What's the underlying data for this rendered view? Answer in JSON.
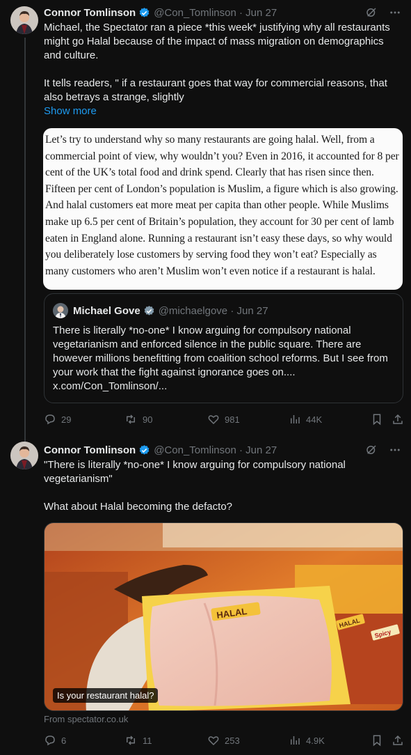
{
  "tweet1": {
    "author_name": "Connor Tomlinson",
    "handle": "@Con_Tomlinson",
    "date": "Jun 27",
    "text_para1": "Michael, the Spectator ran a piece *this week* justifying why all restaurants might go Halal because of the impact of mass migration on demographics and culture.",
    "text_para2": "It tells readers, \" if a restaurant goes that way for commercial reasons, that also betrays a strange, slightly",
    "show_more": "Show more",
    "article_excerpt": "Let’s try to understand why so many restaurants are going halal. Well, from a commercial point of view, why wouldn’t you? Even in 2016, it accounted for 8 per cent of the UK’s total food and drink spend. Clearly that has risen since then. Fifteen per cent of London’s population is Muslim, a figure which is also growing. And halal customers eat more meat per capita than other people. While Muslims make up 6.5 per cent of Britain’s population, they account for 30 per cent of lamb eaten in England alone. Running a restaurant isn’t easy these days, so why would you deliberately lose customers by serving food they won’t eat? Especially as many customers who aren’t Muslim won’t even notice if a restaurant is halal.",
    "quote": {
      "author_name": "Michael Gove",
      "handle": "@michaelgove",
      "date": "Jun 27",
      "text": "There is literally *no-one* I know arguing for compulsory national vegetarianism and enforced silence in the public square. There are however millions benefitting from coalition school reforms. But I see from your work that the fight against ignorance goes on.... x.com/Con_Tomlinson/..."
    },
    "stats": {
      "replies": "29",
      "reposts": "90",
      "likes": "981",
      "views": "44K"
    }
  },
  "tweet2": {
    "author_name": "Connor Tomlinson",
    "handle": "@Con_Tomlinson",
    "date": "Jun 27",
    "text_line1": "\"There is literally *no-one* I know arguing for compulsory national vegetarianism\"",
    "text_line2": "What about Halal becoming the defacto?",
    "media": {
      "caption": "Is your restaurant halal?",
      "label_big": "HALAL",
      "label_small": "HALAL",
      "label_spicy": "Spicy"
    },
    "source": "From spectator.co.uk",
    "stats": {
      "replies": "6",
      "reposts": "11",
      "likes": "253",
      "views": "4.9K"
    }
  },
  "icons": [
    "grok-icon",
    "more-icon",
    "verified-icon",
    "reply-icon",
    "repost-icon",
    "like-icon",
    "views-icon",
    "bookmark-icon",
    "share-icon"
  ],
  "colors": {
    "background": "#0f0f0f",
    "text": "#e7e9ea",
    "muted": "#71767b",
    "link": "#1d9bf0",
    "verified": "#1d9bf0",
    "border": "#2f3336"
  }
}
